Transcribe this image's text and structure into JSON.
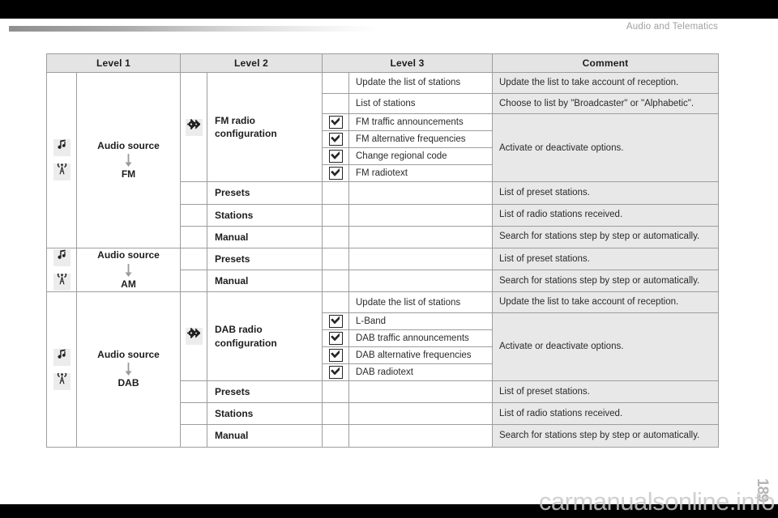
{
  "page": {
    "header_title": "Audio and Telematics",
    "page_number": "189",
    "watermark": "carmanualsonline.info"
  },
  "table": {
    "headers": [
      "Level 1",
      "Level 2",
      "Level 3",
      "Comment"
    ],
    "groups": [
      {
        "level1": {
          "icons": [
            "music-note-icon",
            "radio-antenna-icon"
          ],
          "label_top": "Audio source",
          "arrow": "arrow-down-icon",
          "label_bottom": "FM"
        },
        "level2_blocks": [
          {
            "icon": "gears-icon",
            "label": "FM radio configuration",
            "label_line1": "FM radio",
            "label_line2": "configuration",
            "level3": [
              {
                "checkbox": false,
                "label": "Update the list of stations",
                "comment": "Update the list to take account of reception.",
                "comment_rowspan": 1
              },
              {
                "checkbox": false,
                "label": "List of stations",
                "comment": "Choose to list by \"Broadcaster\" or \"Alphabetic\".",
                "comment_rowspan": 1
              },
              {
                "checkbox": true,
                "label": "FM traffic announcements",
                "comment": "Activate or deactivate options.",
                "comment_rowspan": 4
              },
              {
                "checkbox": true,
                "label": "FM alternative frequencies",
                "comment": null
              },
              {
                "checkbox": true,
                "label": "Change regional code",
                "comment": null
              },
              {
                "checkbox": true,
                "label": "FM radiotext",
                "comment": null
              }
            ]
          },
          {
            "icon": null,
            "label": "Presets",
            "level3": [
              {
                "checkbox": null,
                "label": "",
                "comment": "List of preset stations.",
                "comment_rowspan": 1
              }
            ]
          },
          {
            "icon": null,
            "label": "Stations",
            "level3": [
              {
                "checkbox": null,
                "label": "",
                "comment": "List of radio stations received.",
                "comment_rowspan": 1
              }
            ]
          },
          {
            "icon": null,
            "label": "Manual",
            "level3": [
              {
                "checkbox": null,
                "label": "",
                "comment": "Search for stations step by step or automatically.",
                "comment_rowspan": 1
              }
            ]
          }
        ]
      },
      {
        "level1": {
          "icons": [
            "music-note-icon",
            "radio-antenna-icon"
          ],
          "label_top": "Audio source",
          "arrow": "arrow-down-icon",
          "label_bottom": "AM"
        },
        "level2_blocks": [
          {
            "icon": null,
            "label": "Presets",
            "level3": [
              {
                "checkbox": null,
                "label": "",
                "comment": "List of preset stations.",
                "comment_rowspan": 1
              }
            ]
          },
          {
            "icon": null,
            "label": "Manual",
            "level3": [
              {
                "checkbox": null,
                "label": "",
                "comment": "Search for stations step by step or automatically.",
                "comment_rowspan": 1
              }
            ]
          }
        ]
      },
      {
        "level1": {
          "icons": [
            "music-note-icon",
            "radio-antenna-icon"
          ],
          "label_top": "Audio source",
          "arrow": "arrow-down-icon",
          "label_bottom": "DAB"
        },
        "level2_blocks": [
          {
            "icon": "gears-icon",
            "label": "DAB radio configuration",
            "label_line1": "DAB radio",
            "label_line2": "configuration",
            "level3": [
              {
                "checkbox": false,
                "label": "Update the list of stations",
                "comment": "Update the list to take account of reception.",
                "comment_rowspan": 1
              },
              {
                "checkbox": true,
                "label": "L-Band",
                "comment": "Activate or deactivate options.",
                "comment_rowspan": 4
              },
              {
                "checkbox": true,
                "label": "DAB traffic announcements",
                "comment": null
              },
              {
                "checkbox": true,
                "label": "DAB alternative frequencies",
                "comment": null
              },
              {
                "checkbox": true,
                "label": "DAB radiotext",
                "comment": null
              }
            ]
          },
          {
            "icon": null,
            "label": "Presets",
            "level3": [
              {
                "checkbox": null,
                "label": "",
                "comment": "List of preset stations.",
                "comment_rowspan": 1
              }
            ]
          },
          {
            "icon": null,
            "label": "Stations",
            "level3": [
              {
                "checkbox": null,
                "label": "",
                "comment": "List of radio stations received.",
                "comment_rowspan": 1
              }
            ]
          },
          {
            "icon": null,
            "label": "Manual",
            "level3": [
              {
                "checkbox": null,
                "label": "",
                "comment": "Search for stations step by step or automatically.",
                "comment_rowspan": 1
              }
            ]
          }
        ]
      }
    ]
  }
}
